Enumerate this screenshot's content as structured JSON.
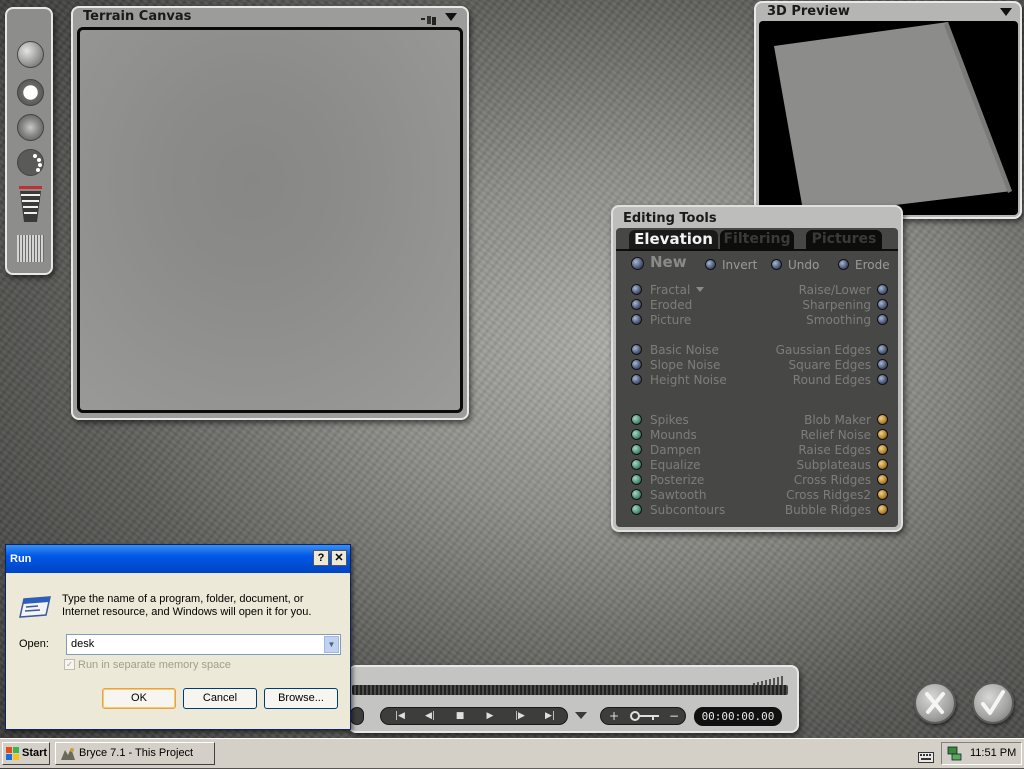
{
  "colors": {
    "bullet_blue": "#4a5878",
    "bullet_green": "#4c8a72",
    "bullet_orange": "#b0822c",
    "xp_title_blue": "#0058e6"
  },
  "terrain_canvas": {
    "title": "Terrain Canvas"
  },
  "preview": {
    "title": "3D Preview"
  },
  "palette": {
    "tools": [
      "sphere-brush-icon",
      "hard-brush-icon",
      "soft-brush-icon",
      "brush-spacing-icon",
      "brush-level-icon",
      "grid-resolution-icon"
    ]
  },
  "editing_tools": {
    "title": "Editing Tools",
    "tabs": [
      "Elevation",
      "Filtering",
      "Pictures"
    ],
    "active_tab": "Elevation",
    "top_actions": {
      "new": "New",
      "invert": "Invert",
      "undo": "Undo",
      "erode": "Erode"
    },
    "left_col_1": [
      "Fractal",
      "Eroded",
      "Picture"
    ],
    "right_col_1": [
      "Raise/Lower",
      "Sharpening",
      "Smoothing"
    ],
    "left_col_2": [
      "Basic Noise",
      "Slope Noise",
      "Height Noise"
    ],
    "right_col_2": [
      "Gaussian Edges",
      "Square Edges",
      "Round Edges"
    ],
    "left_col_3": [
      "Spikes",
      "Mounds",
      "Dampen",
      "Equalize",
      "Posterize",
      "Sawtooth",
      "Subcontours"
    ],
    "right_col_3": [
      "Blob Maker",
      "Relief Noise",
      "Raise Edges",
      "Subplateaus",
      "Cross Ridges",
      "Cross Ridges2",
      "Bubble Ridges"
    ]
  },
  "animation": {
    "time": "00:00:00.00"
  },
  "run_dialog": {
    "title": "Run",
    "help": "?",
    "close": "✕",
    "description_line1": "Type the name of a program, folder, document, or",
    "description_line2": "Internet resource, and Windows will open it for you.",
    "open_label": "Open:",
    "open_value": "desk",
    "separate_memory_label": "Run in separate memory space",
    "ok": "OK",
    "cancel": "Cancel",
    "browse": "Browse..."
  },
  "taskbar": {
    "start": "Start",
    "task": "Bryce 7.1 - This Project",
    "clock": "11:51 PM"
  }
}
